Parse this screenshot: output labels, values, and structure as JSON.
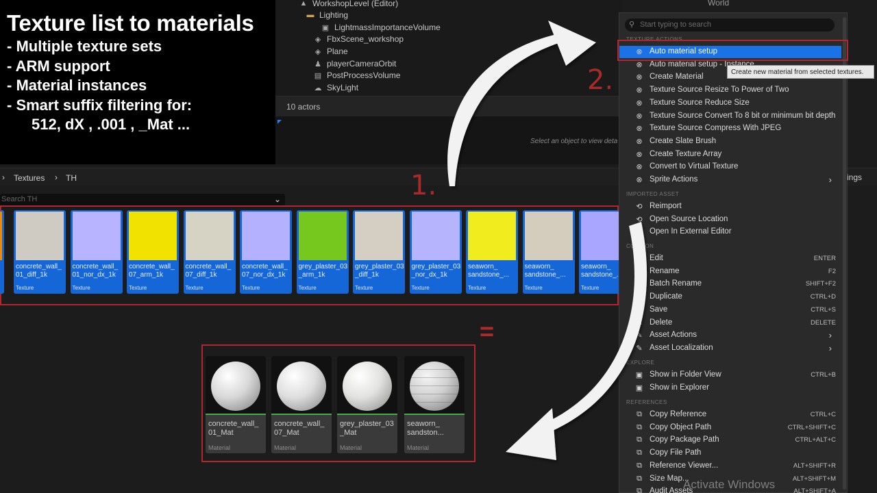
{
  "promo": {
    "title": "Texture list to materials",
    "lines": [
      "- Multiple texture sets",
      "- ARM support",
      "- Material instances",
      "- Smart suffix filtering for:"
    ],
    "suffix_examples": "512, dX , .001 , _Mat ..."
  },
  "outliner": {
    "world_label": "World",
    "items": [
      "WorkshopLevel (Editor)",
      "Lighting",
      "LightmassImportanceVolume",
      "FbxScene_workshop",
      "Plane",
      "playerCameraOrbit",
      "PostProcessVolume",
      "SkyLight"
    ],
    "actor_count": "10 actors",
    "details_hint": "Select an object to view deta"
  },
  "content_browser": {
    "breadcrumb": [
      "Textures",
      "TH"
    ],
    "settings_label": "ings",
    "search_placeholder": "Search TH",
    "textures": [
      {
        "name": "concrete_wall_\n01_diff_1k",
        "type": "Texture",
        "color": "#cfcbc2"
      },
      {
        "name": "concrete_wall_\n01_nor_dx_1k",
        "type": "Texture",
        "color": "#b8b4ff"
      },
      {
        "name": "concrete_wall_\n07_arm_1k",
        "type": "Texture",
        "color": "#f2e200"
      },
      {
        "name": "concrete_wall_\n07_diff_1k",
        "type": "Texture",
        "color": "#d6d2c4"
      },
      {
        "name": "concrete_wall_\n07_nor_dx_1k",
        "type": "Texture",
        "color": "#b4b2ff"
      },
      {
        "name": "grey_plaster_03\n_arm_1k",
        "type": "Texture",
        "color": "#76c81e"
      },
      {
        "name": "grey_plaster_03\n_diff_1k",
        "type": "Texture",
        "color": "#d4cfc2"
      },
      {
        "name": "grey_plaster_03\n_nor_dx_1k",
        "type": "Texture",
        "color": "#b6b4fc"
      },
      {
        "name": "seaworn_\nsandstone_...",
        "type": "Texture",
        "color": "#f0ec1e"
      },
      {
        "name": "seaworn_\nsandstone_...",
        "type": "Texture",
        "color": "#d4cdbd"
      },
      {
        "name": "seaworn_\nsandstone_...",
        "type": "Texture",
        "color": "#a9a6ff"
      }
    ],
    "materials": [
      {
        "name": "concrete_wall_\n01_Mat",
        "type": "Material"
      },
      {
        "name": "concrete_wall_\n07_Mat",
        "type": "Material"
      },
      {
        "name": "grey_plaster_03\n_Mat",
        "type": "Material"
      },
      {
        "name": "seaworn_\nsandston...",
        "type": "Material"
      }
    ]
  },
  "labels": {
    "step1": "1.",
    "step2": "2.",
    "equals": "="
  },
  "menu": {
    "search_placeholder": "Start typing to search",
    "sections": {
      "texture_actions": "TEXTURE ACTIONS",
      "imported_asset": "IMPORTED ASSET",
      "common": "COMMON",
      "explore": "EXPLORE",
      "references": "REFERENCES"
    },
    "texture_actions": [
      {
        "label": "Auto material setup"
      },
      {
        "label": "Auto material setup - Instance"
      },
      {
        "label": "Create Material"
      },
      {
        "label": "Texture Source Resize To Power of Two"
      },
      {
        "label": "Texture Source Reduce Size"
      },
      {
        "label": "Texture Source Convert To 8 bit or minimum bit depth"
      },
      {
        "label": "Texture Source Compress With JPEG"
      },
      {
        "label": "Create Slate Brush"
      },
      {
        "label": "Create Texture Array"
      },
      {
        "label": "Convert to Virtual Texture"
      },
      {
        "label": "Sprite Actions"
      }
    ],
    "imported_asset": [
      {
        "label": "Reimport"
      },
      {
        "label": "Open Source Location"
      },
      {
        "label": "Open In External Editor"
      }
    ],
    "common": [
      {
        "label": "Edit",
        "shortcut": "ENTER"
      },
      {
        "label": "Rename",
        "shortcut": "F2"
      },
      {
        "label": "Batch Rename",
        "shortcut": "SHIFT+F2"
      },
      {
        "label": "Duplicate",
        "shortcut": "CTRL+D"
      },
      {
        "label": "Save",
        "shortcut": "CTRL+S"
      },
      {
        "label": "Delete",
        "shortcut": "DELETE"
      },
      {
        "label": "Asset Actions"
      },
      {
        "label": "Asset Localization"
      }
    ],
    "explore": [
      {
        "label": "Show in Folder View",
        "shortcut": "CTRL+B"
      },
      {
        "label": "Show in Explorer"
      }
    ],
    "references": [
      {
        "label": "Copy Reference",
        "shortcut": "CTRL+C"
      },
      {
        "label": "Copy Object Path",
        "shortcut": "CTRL+SHIFT+C"
      },
      {
        "label": "Copy Package Path",
        "shortcut": "CTRL+ALT+C"
      },
      {
        "label": "Copy File Path"
      },
      {
        "label": "Reference Viewer...",
        "shortcut": "ALT+SHIFT+R"
      },
      {
        "label": "Size Map...",
        "shortcut": "ALT+SHIFT+M"
      },
      {
        "label": "Audit Assets",
        "shortcut": "ALT+SHIFT+A"
      }
    ],
    "tooltip": "Create new material from selected textures."
  },
  "watermark": "Activate Windows",
  "colors": {
    "accent": "#1a72e6",
    "highlight_frame": "#b3262b",
    "texture_card": "#1567d8"
  }
}
